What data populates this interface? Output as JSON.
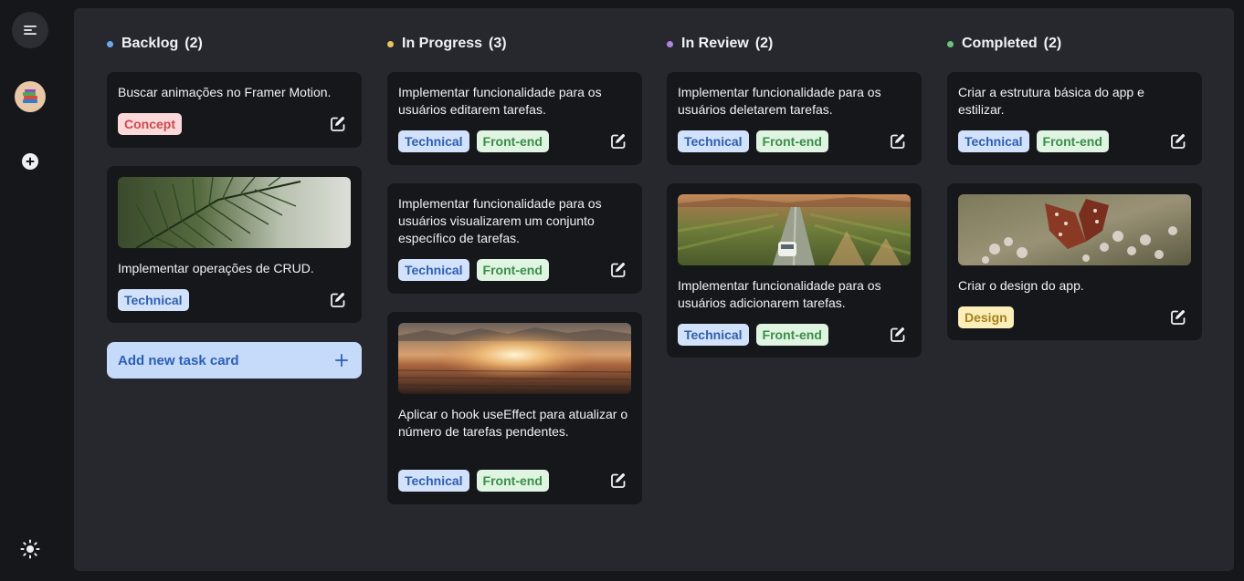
{
  "colors": {
    "board_bg": "#26282e",
    "card_bg": "#16171b",
    "add_button_bg": "#c6daf9",
    "add_button_text": "#2b5fb6"
  },
  "sidebar": {
    "icons": [
      "menu-icon",
      "books-avatar-icon",
      "add-circle-icon",
      "sun-icon"
    ]
  },
  "tag_styles": {
    "Technical": {
      "bg": "#d3e2fb",
      "fg": "#2f5fae"
    },
    "Front-end": {
      "bg": "#dff4e1",
      "fg": "#3b8e49"
    },
    "Concept": {
      "bg": "#fbd8d9",
      "fg": "#c94c50"
    },
    "Design": {
      "bg": "#fbeeb9",
      "fg": "#a5801d"
    }
  },
  "board": {
    "add_card_label": "Add new task card",
    "columns": [
      {
        "name": "Backlog",
        "count": "(2)",
        "dot_color": "#6ea8e8",
        "cards": [
          {
            "title": "Buscar animações no Framer Motion.",
            "tags": [
              "Concept"
            ],
            "image": null
          },
          {
            "title": "Implementar operações de CRUD.",
            "tags": [
              "Technical"
            ],
            "image": "pine-branch"
          }
        ]
      },
      {
        "name": "In Progress",
        "count": "(3)",
        "dot_color": "#e8c35a",
        "cards": [
          {
            "title": "Implementar funcionalidade para os usuários editarem tarefas.",
            "tags": [
              "Technical",
              "Front-end"
            ],
            "image": null
          },
          {
            "title": "Implementar funcionalidade para os usuários visualizarem um conjunto específico de tarefas.",
            "tags": [
              "Technical",
              "Front-end"
            ],
            "image": null
          },
          {
            "title": "Aplicar o hook useEffect para atualizar o número de tarefas pendentes.",
            "tags": [
              "Technical",
              "Front-end"
            ],
            "image": "sunrise-sea"
          }
        ]
      },
      {
        "name": "In Review",
        "count": "(2)",
        "dot_color": "#b085e0",
        "cards": [
          {
            "title": "Implementar funcionalidade para os usuários deletarem tarefas.",
            "tags": [
              "Technical",
              "Front-end"
            ],
            "image": null
          },
          {
            "title": "Implementar funcionalidade para os usuários adicionarem tarefas.",
            "tags": [
              "Technical",
              "Front-end"
            ],
            "image": "van-on-road"
          }
        ]
      },
      {
        "name": "Completed",
        "count": "(2)",
        "dot_color": "#6cc47e",
        "cards": [
          {
            "title": "Criar a estrutura básica do app e estilizar.",
            "tags": [
              "Technical",
              "Front-end"
            ],
            "image": null
          },
          {
            "title": "Criar o design do app.",
            "tags": [
              "Design"
            ],
            "image": "butterfly-flowers"
          }
        ]
      }
    ]
  }
}
